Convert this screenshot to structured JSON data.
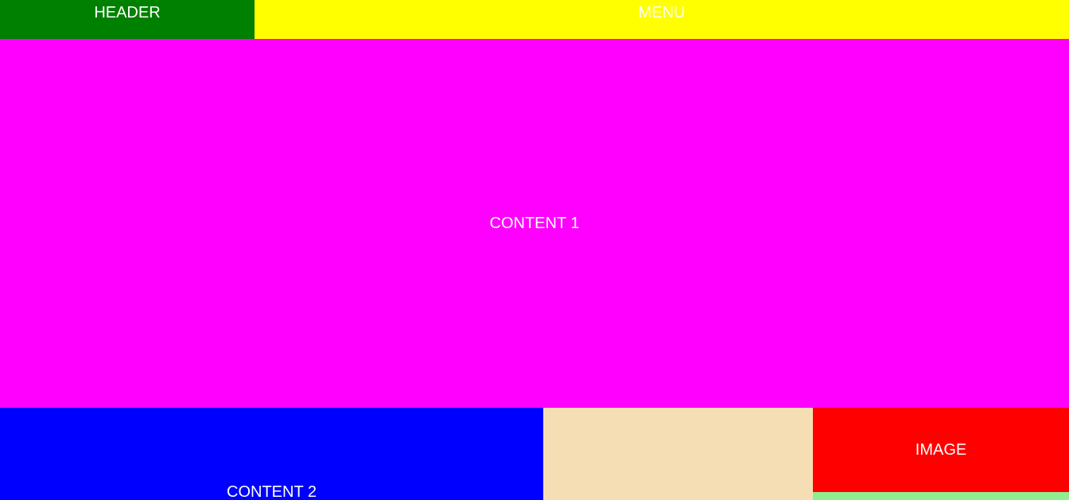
{
  "header": {
    "label": "HEADER",
    "color": "#008000"
  },
  "menu": {
    "label": "MENU",
    "color": "#ffff00"
  },
  "content1": {
    "label": "CONTENT 1",
    "color": "#ff00ff"
  },
  "content2": {
    "label": "CONTENT 2",
    "color": "#0000ff"
  },
  "tan_panel": {
    "color": "#f5deb3"
  },
  "image": {
    "label": "IMAGE",
    "color": "#ff0000"
  },
  "green_strip": {
    "color": "#90ee90"
  }
}
